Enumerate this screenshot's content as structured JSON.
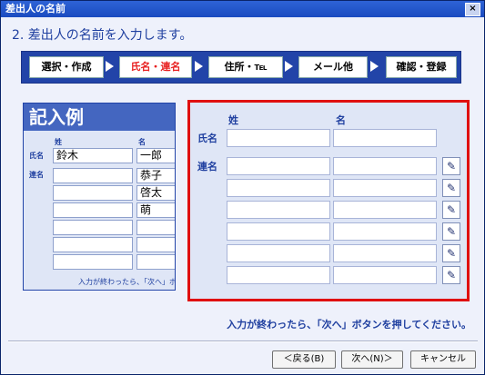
{
  "window": {
    "title": "差出人の名前",
    "close": "×"
  },
  "heading": "2. 差出人の名前を入力します。",
  "steps": [
    {
      "label": "選択・作成"
    },
    {
      "label": "氏名・連名",
      "active": true
    },
    {
      "label": "住所・℡"
    },
    {
      "label": "メール他"
    },
    {
      "label": "確認・登録"
    }
  ],
  "example": {
    "title": "記入例",
    "col_sei": "姓",
    "col_mei": "名",
    "row_name": "氏名",
    "row_renmei": "連名",
    "name_sei": "鈴木",
    "name_mei": "一郎",
    "renmei": [
      "恭子",
      "啓太",
      "萌"
    ],
    "note": "入力が終わったら、「次へ」ボ"
  },
  "form": {
    "col_sei": "姓",
    "col_mei": "名",
    "row_name": "氏名",
    "row_renmei": "連名",
    "addr_icon": "✎"
  },
  "footnote": "入力が終わったら、「次へ」ボタンを押してください。",
  "buttons": {
    "back": "＜戻る(B)",
    "next": "次へ(N)＞",
    "cancel": "キャンセル"
  }
}
